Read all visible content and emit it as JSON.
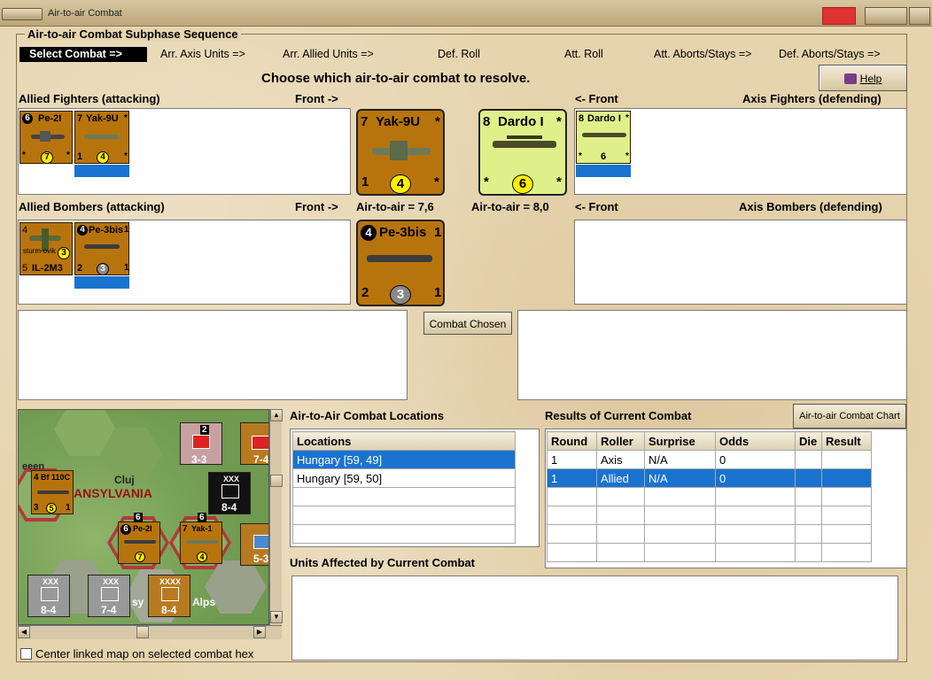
{
  "window": {
    "title": "Air-to-air Combat"
  },
  "sequence": {
    "title": "Air-to-air Combat Subphase Sequence",
    "steps": [
      "Select Combat =>",
      "Arr. Axis Units =>",
      "Arr. Allied Units =>",
      "Def. Roll",
      "Att. Roll",
      "Att. Aborts/Stays =>",
      "Def. Aborts/Stays =>"
    ]
  },
  "instruction": "Choose which air-to-air combat to resolve.",
  "help_label": "Help",
  "headers": {
    "allied_fighters": "Allied Fighters (attacking)",
    "front_right": "Front ->",
    "front_left": "<- Front",
    "axis_fighters": "Axis Fighters (defending)",
    "allied_bombers": "Allied Bombers (attacking)",
    "axis_bombers": "Axis Bombers (defending)",
    "allied_ata": "Air-to-air = 7,6",
    "axis_ata": "Air-to-air = 8,0"
  },
  "counters": {
    "pe2i": {
      "tl": "6",
      "name": "Pe-2I",
      "bot": "7",
      "l": "*",
      "r": "*"
    },
    "yak9u_small": {
      "tl": "7",
      "name": "Yak-9U",
      "l": "1",
      "bot": "4",
      "r": "*",
      "tr": "*"
    },
    "yak9u_big": {
      "tl": "7",
      "name": "Yak-9U",
      "tr": "*",
      "l": "1",
      "bot": "4",
      "r": "*"
    },
    "dardo_big": {
      "tl": "8",
      "name": "Dardo I",
      "tr": "*",
      "l": "*",
      "bot": "6",
      "r": "*"
    },
    "dardo_small": {
      "tl": "8",
      "name": "Dardo I",
      "tr": "*",
      "l": "*",
      "bot": "6",
      "r": "*"
    },
    "il2m3": {
      "tl": "4",
      "mid": "sturm-ovik",
      "name": "IL-2M3",
      "l": "5",
      "bot": "3"
    },
    "pe3bis_small": {
      "tl": "4",
      "name": "Pe-3bis",
      "tr": "1",
      "l": "2",
      "bot": "3",
      "r": "1"
    },
    "pe3bis_big": {
      "tl": "4",
      "name": "Pe-3bis",
      "tr": "1",
      "l": "2",
      "bot": "3",
      "r": "1"
    }
  },
  "combat_chosen_label": "Combat Chosen",
  "locations": {
    "title": "Air-to-Air Combat Locations",
    "header": "Locations",
    "rows": [
      "Hungary [59, 49]",
      "Hungary [59, 50]",
      "",
      "",
      ""
    ],
    "selected": 0
  },
  "results": {
    "title": "Results of Current Combat",
    "chart_button": "Air-to-air Combat Chart",
    "columns": [
      "Round",
      "Roller",
      "Surprise",
      "Odds",
      "Die",
      "Result"
    ],
    "rows": [
      [
        "1",
        "Axis",
        "N/A",
        "0",
        "",
        ""
      ],
      [
        "1",
        "Allied",
        "N/A",
        "0",
        "",
        ""
      ],
      [
        "",
        "",
        "",
        "",
        "",
        ""
      ],
      [
        "",
        "",
        "",
        "",
        "",
        ""
      ],
      [
        "",
        "",
        "",
        "",
        "",
        ""
      ],
      [
        "",
        "",
        "",
        "",
        "",
        ""
      ]
    ],
    "selected": 1
  },
  "units_affected": {
    "title": "Units Affected by Current Combat"
  },
  "map": {
    "labels": {
      "cluj": "Cluj",
      "region": "ANSYLVANIA",
      "alps": "Alps",
      "sy": "sy",
      "eeen": "eeen"
    },
    "counters": {
      "bf110": {
        "tl": "4",
        "name": "Bf 110C",
        "l": "3",
        "bot": "5",
        "r": "1"
      },
      "pe2i": {
        "tl": "6",
        "name": "Pe-2I",
        "bot": "7"
      },
      "yak": {
        "tl": "7",
        "name": "Yak-1",
        "bot": "4"
      },
      "inf33": {
        "top": "2",
        "val": "3-3"
      },
      "inf74a": {
        "val": "7-4"
      },
      "inf84a": {
        "top": "XXX",
        "val": "8-4"
      },
      "inf53": {
        "val": "5-3"
      },
      "inf84b": {
        "top": "XXX",
        "val": "8-4"
      },
      "inf74b": {
        "top": "XXX",
        "val": "7-4"
      },
      "inf84c": {
        "top": "XXXX",
        "val": "8-4"
      },
      "hex6a": "6",
      "hex6b": "6"
    }
  },
  "center_map_label": "Center linked map on selected combat hex"
}
